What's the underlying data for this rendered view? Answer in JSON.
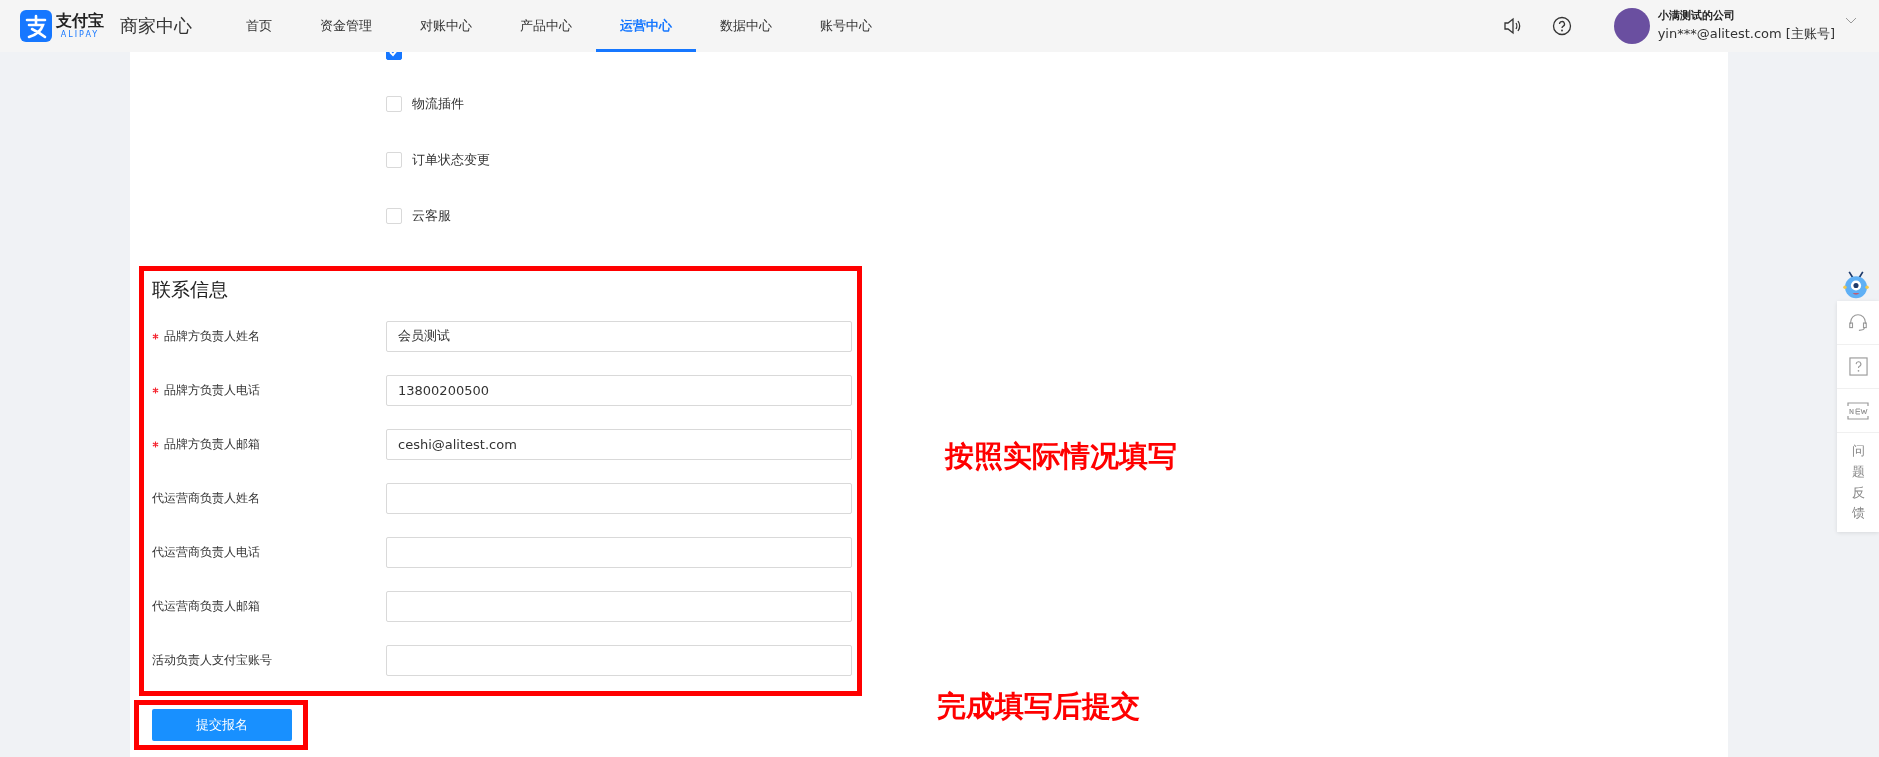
{
  "header": {
    "logo": {
      "name": "支付宝",
      "subname": "ALIPAY"
    },
    "product": "商家中心",
    "nav": [
      {
        "label": "首页",
        "selected": false
      },
      {
        "label": "资金管理",
        "selected": false
      },
      {
        "label": "对账中心",
        "selected": false
      },
      {
        "label": "产品中心",
        "selected": false
      },
      {
        "label": "运营中心",
        "selected": true
      },
      {
        "label": "数据中心",
        "selected": false
      },
      {
        "label": "账号中心",
        "selected": false
      }
    ],
    "user": {
      "company": "小满测试的公司",
      "account": "yin***@alitest.com [主账号]"
    }
  },
  "options": [
    {
      "checked": true
    },
    {
      "label": "物流插件",
      "checked": false
    },
    {
      "label": "订单状态变更",
      "checked": false
    },
    {
      "label": "云客服",
      "checked": false
    }
  ],
  "contact": {
    "title": "联系信息",
    "fields": [
      {
        "label": "品牌方负责人姓名",
        "required": true,
        "value": "会员测试"
      },
      {
        "label": "品牌方负责人电话",
        "required": true,
        "value": "13800200500"
      },
      {
        "label": "品牌方负责人邮箱",
        "required": true,
        "value": "ceshi@alitest.com"
      },
      {
        "label": "代运营商负责人姓名",
        "required": false
      },
      {
        "label": "代运营商负责人电话",
        "required": false
      },
      {
        "label": "代运营商负责人邮箱",
        "required": false
      },
      {
        "label": "活动负责人支付宝账号",
        "required": false
      }
    ]
  },
  "submit": "提交报名",
  "annotations": [
    "按照实际情况填写",
    "完成填写后提交"
  ],
  "side_panel": {
    "feedback": "问题反馈"
  }
}
